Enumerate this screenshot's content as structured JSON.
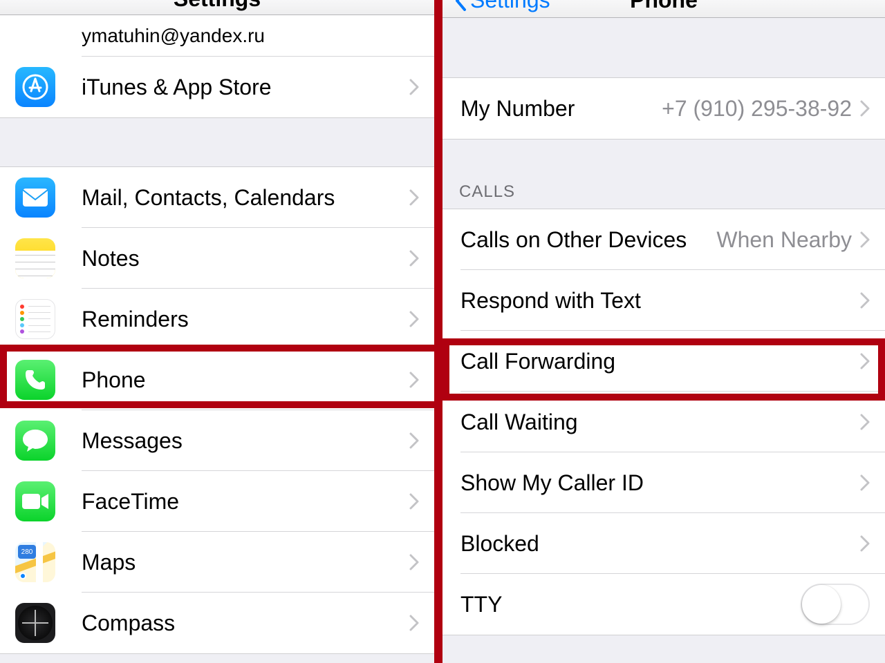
{
  "left": {
    "nav_title": "Settings",
    "icloud_sub": "ymatuhin@yandex.ru",
    "items": {
      "itunes": "iTunes & App Store",
      "mail": "Mail, Contacts, Calendars",
      "notes": "Notes",
      "reminders": "Reminders",
      "phone": "Phone",
      "messages": "Messages",
      "facetime": "FaceTime",
      "maps": "Maps",
      "compass": "Compass"
    },
    "maps_sign": "280"
  },
  "right": {
    "nav_title": "Phone",
    "back_label": "Settings",
    "my_number_label": "My Number",
    "my_number_value": "+7 (910) 295-38-92",
    "section_calls": "CALLS",
    "calls_other_label": "Calls on Other Devices",
    "calls_other_value": "When Nearby",
    "respond_text": "Respond with Text",
    "call_forwarding": "Call Forwarding",
    "call_waiting": "Call Waiting",
    "show_caller_id": "Show My Caller ID",
    "blocked": "Blocked",
    "tty": "TTY",
    "tty_on": false
  }
}
